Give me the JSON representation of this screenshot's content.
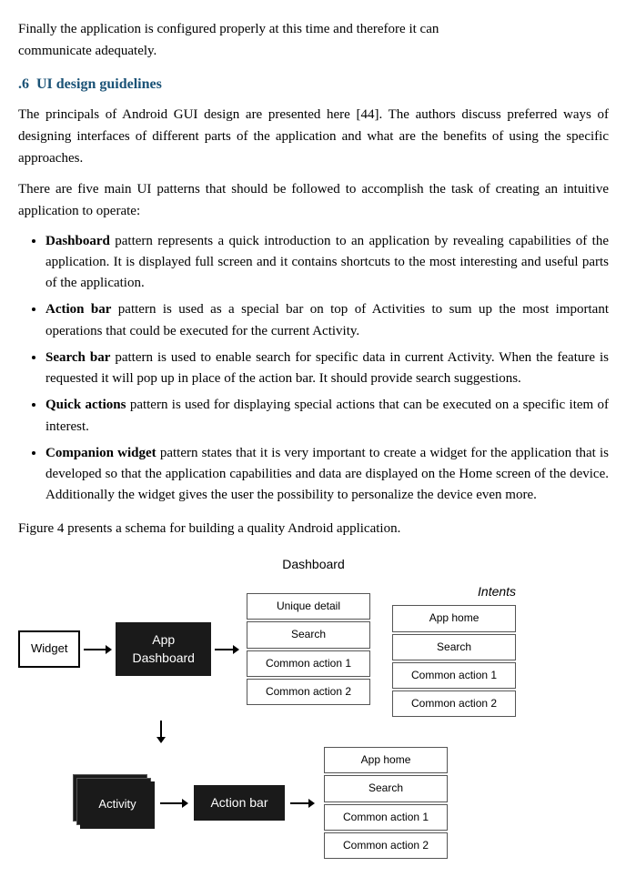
{
  "intro": {
    "line1": "Finally the application is configured properly at this time and therefore it can",
    "line2": "communicate adequately."
  },
  "section": {
    "number": ".6",
    "title": "UI design guidelines"
  },
  "para1": {
    "text": "The principals of Android GUI design are presented here [44]. The authors discuss preferred ways of designing interfaces of different parts of the application and what are the benefits of using the specific approaches."
  },
  "para2": {
    "text": "There are five main UI patterns that should be followed to accomplish the task of creating an intuitive application to operate:"
  },
  "bullets": [
    {
      "term": "Dashboard",
      "text": " pattern represents a quick introduction to an application by revealing capabilities of the application. It is displayed full screen and it contains shortcuts to the most interesting and useful parts of the application."
    },
    {
      "term": "Action bar",
      "text": " pattern is used as a special bar on top of Activities to sum up the most important operations that could be executed for the current Activity."
    },
    {
      "term": "Search bar",
      "text": " pattern is used to enable search for specific data in current Activity. When the feature is requested it will pop up in place of the action bar. It should provide search suggestions."
    },
    {
      "term": "Quick actions",
      "text": " pattern is used for displaying special actions that can be executed on a specific item of interest."
    },
    {
      "term": "Companion widget",
      "text": " pattern states that it is very important to create a widget for the application that is developed so that the application capabilities and data are displayed on the Home screen of the device. Additionally the widget gives the user the possibility to personalize the device even more."
    }
  ],
  "figure_caption": "Figure 4 presents a schema for building a quality Android application.",
  "diagram": {
    "title": "Dashboard",
    "intents_label": "Intents",
    "widget_label": "Widget",
    "app_dashboard_label": "App\nDashboard",
    "activity_label": "Activity",
    "action_bar_label": "Action bar",
    "dashboard_items": [
      "Unique detail",
      "Search",
      "Common action 1",
      "Common action 2"
    ],
    "intents_items": [
      "App home",
      "Search",
      "Common action 1",
      "Common action 2"
    ]
  }
}
